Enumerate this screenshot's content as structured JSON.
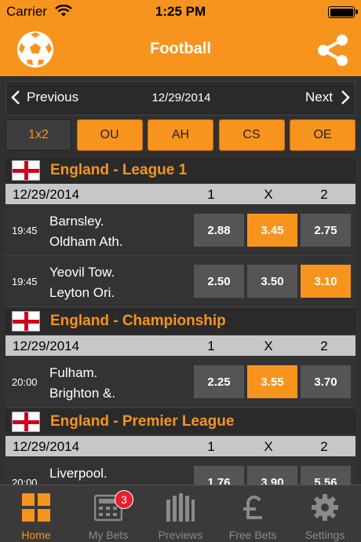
{
  "status": {
    "carrier": "Carrier",
    "time": "1:25 PM"
  },
  "nav": {
    "title": "Football",
    "left_icon": "football-icon",
    "right_icon": "share-icon"
  },
  "date_nav": {
    "prev": "Previous",
    "date": "12/29/2014",
    "next": "Next"
  },
  "markets": [
    "1x2",
    "OU",
    "AH",
    "CS",
    "OE"
  ],
  "col_labels": [
    "1",
    "X",
    "2"
  ],
  "leagues": [
    {
      "name": "England - League 1",
      "date": "12/29/2014",
      "matches": [
        {
          "time": "19:45",
          "home": "Barnsley.",
          "away": "Oldham Ath.",
          "odds": [
            "2.88",
            "3.45",
            "2.75"
          ]
        },
        {
          "time": "19:45",
          "home": "Yeovil Tow.",
          "away": "Leyton Ori.",
          "odds": [
            "2.50",
            "3.50",
            "3.10"
          ]
        }
      ]
    },
    {
      "name": "England - Championship",
      "date": "12/29/2014",
      "matches": [
        {
          "time": "20:00",
          "home": "Fulham.",
          "away": "Brighton &.",
          "odds": [
            "2.25",
            "3.55",
            "3.70"
          ]
        }
      ]
    },
    {
      "name": "England - Premier League",
      "date": "12/29/2014",
      "matches": [
        {
          "time": "20:00",
          "home": "Liverpool.",
          "away": "",
          "odds": [
            "1.76",
            "3.90",
            "5.56"
          ]
        }
      ]
    }
  ],
  "tabbar": [
    {
      "label": "Home",
      "icon": "grid-icon"
    },
    {
      "label": "My Bets",
      "icon": "calculator-icon",
      "badge": "3"
    },
    {
      "label": "Previews",
      "icon": "bars-icon"
    },
    {
      "label": "Free Bets",
      "icon": "pound-icon"
    },
    {
      "label": "Settings",
      "icon": "gear-icon"
    }
  ],
  "colors": {
    "accent": "#f7941d",
    "background": "#303030",
    "flag_red": "#d0021b",
    "badge": "#e8202a"
  }
}
